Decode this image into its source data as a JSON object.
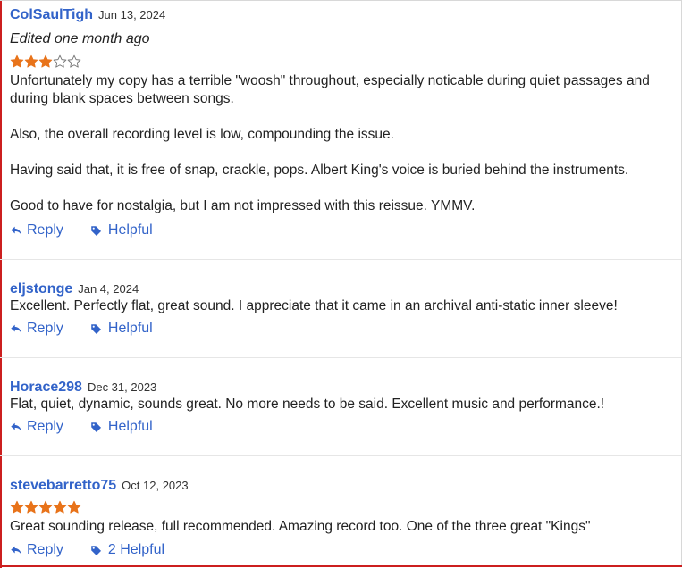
{
  "colors": {
    "link": "#3263c9",
    "star": "#e8731a",
    "accent_border": "#cc1f1f"
  },
  "reviews": [
    {
      "username": "ColSaulTigh",
      "date": "Jun 13, 2024",
      "edited": "Edited one month ago",
      "rating": 3,
      "paragraphs": [
        "Unfortunately my copy has a terrible \"woosh\" throughout, especially noticable during quiet passages and during blank spaces between songs.",
        "Also, the overall recording level is low, compounding the issue.",
        "Having said that, it is free of snap, crackle, pops. Albert King's voice is buried behind the instruments.",
        "Good to have for nostalgia, but I am not impressed with this reissue. YMMV."
      ],
      "reply_label": "Reply",
      "helpful_label": "Helpful"
    },
    {
      "username": "eljstonge",
      "date": "Jan 4, 2024",
      "text": "Excellent. Perfectly flat, great sound. I appreciate that it came in an archival anti-static inner sleeve!",
      "reply_label": "Reply",
      "helpful_label": "Helpful"
    },
    {
      "username": "Horace298",
      "date": "Dec 31, 2023",
      "text": "Flat, quiet, dynamic, sounds great. No more needs to be said. Excellent music and performance.!",
      "reply_label": "Reply",
      "helpful_label": "Helpful"
    },
    {
      "username": "stevebarretto75",
      "date": "Oct 12, 2023",
      "rating": 5,
      "text": "Great sounding release, full recommended. Amazing record too. One of the three great \"Kings\"",
      "reply_label": "Reply",
      "helpful_label": "2 Helpful"
    }
  ]
}
